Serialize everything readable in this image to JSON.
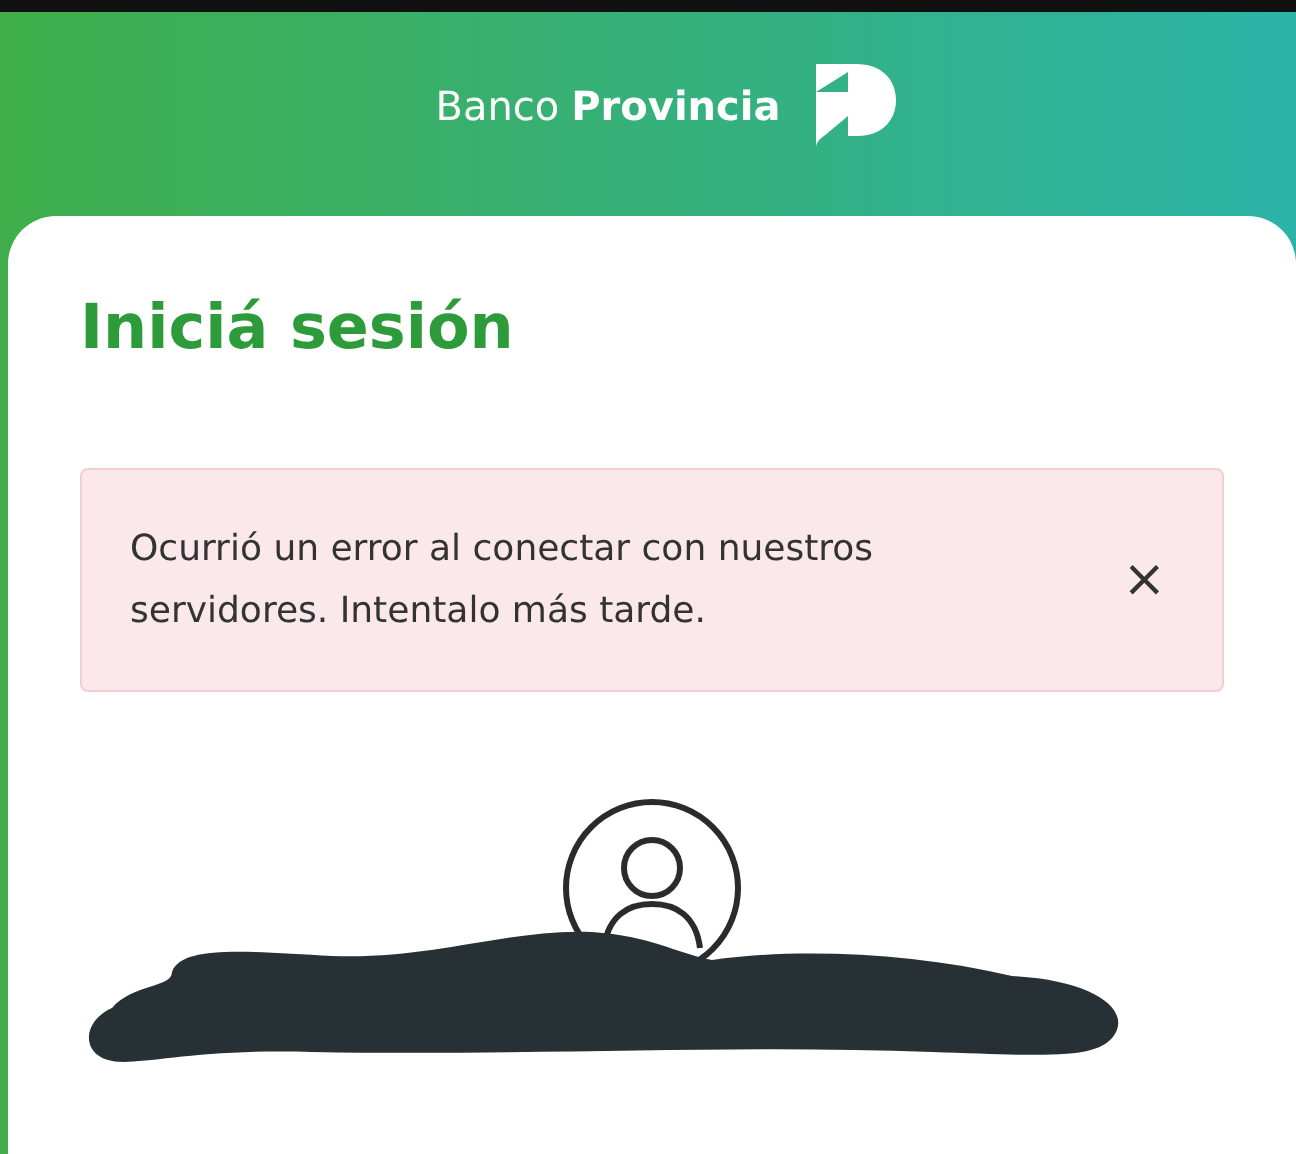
{
  "header": {
    "brand_regular": "Banco",
    "brand_bold": "Provincia"
  },
  "login": {
    "title": "Iniciá sesión",
    "alert": {
      "message": "Ocurrió un error al conectar con nuestros servidores. Intentalo más tarde.",
      "close": "×"
    }
  }
}
